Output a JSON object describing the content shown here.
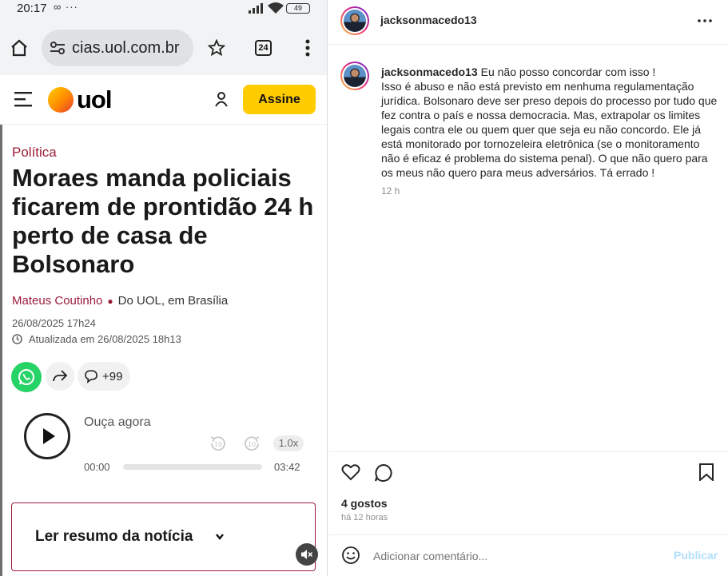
{
  "phone": {
    "status_bar": {
      "time": "20:17",
      "extra": "∞ ···",
      "battery": "49"
    },
    "browser": {
      "url": "cias.uol.com.br",
      "tab_count": "24"
    },
    "site_header": {
      "logo_text": "uol",
      "subscribe_label": "Assine"
    },
    "article": {
      "category": "Política",
      "headline": "Moraes manda policiais ficarem de prontidão 24 h perto de casa de Bolsonaro",
      "author": "Mateus Coutinho",
      "source": "Do UOL, em Brasília",
      "published": "26/08/2025 17h24",
      "updated": "Atualizada em 26/08/2025 18h13",
      "comment_count": "+99"
    },
    "audio": {
      "label": "Ouça agora",
      "speed": "1.0x",
      "current_time": "00:00",
      "duration": "03:42",
      "progress": 0
    },
    "summary": {
      "label": "Ler resumo da notícia"
    }
  },
  "instagram": {
    "post_author": "jacksonmacedo13",
    "comment": {
      "username": "jacksonmacedo13",
      "text": "Eu não posso concordar com isso !\nIsso é abuso e não está previsto em nenhuma regulamentação jurídica. Bolsonaro deve ser preso depois do processo por tudo que fez contra o país e nossa democracia. Mas, extrapolar os limites legais contra ele ou quem quer que seja eu não concordo. Ele já está monitorado por tornozeleira eletrônica (se o monitoramento não é eficaz é problema do sistema penal). O que não quero para os meus não quero para meus adversários. Tá errado !",
      "time": "12 h"
    },
    "likes": "4 gostos",
    "posted_ago": "há 12 horas",
    "comment_box": {
      "placeholder": "Adicionar comentário...",
      "submit_label": "Publicar"
    },
    "colors": {
      "link_blue_disabled": "#b2dffc",
      "text": "#262626",
      "muted": "#8e8e8e"
    }
  },
  "colors": {
    "uol_accent": "#9b1c3a",
    "subscribe_yellow": "#ffcc00",
    "whatsapp": "#25d366"
  }
}
